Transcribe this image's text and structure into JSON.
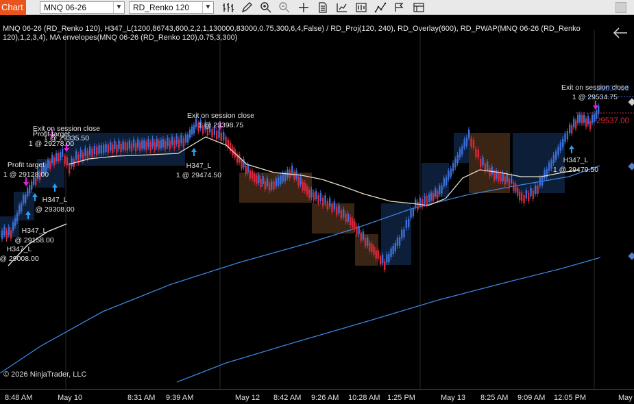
{
  "toolbar": {
    "chart_tab": "Chart",
    "instrument": "MNQ 06-26",
    "bar_type": "RD_Renko 120",
    "icons": [
      "bars-type-icon",
      "pencil-icon",
      "zoom-in-icon",
      "zoom-out-icon",
      "crosshair-icon",
      "data-box-icon",
      "indicators-icon",
      "strategies-icon",
      "drawing-tools-icon",
      "properties-icon",
      "order-entry-icon"
    ]
  },
  "chart": {
    "indicator_label": "MNQ 06-26 (RD_Renko 120), H347_L(1200,86743,600,2,2,1,130000,83000,0.75,300,6,4,False) / RD_Proj(120, 240), RD_Overlay(600), RD_PWAP(MNQ 06-26 (RD_Renko 120),1,2,3,4), MA envelopes(MNQ 06-26 (RD_Renko 120),0.75,3,300)",
    "copyright": "© 2026 NinjaTrader, LLC",
    "price_labels": [
      "29537.00",
      "29537.00"
    ],
    "colors": {
      "up": "#3a6fd8",
      "down": "#d8283a",
      "envelope": "#3a86e0",
      "pwap": "#e8e0cc",
      "box_blue": "#0d1e38",
      "box_brown": "#3a2414",
      "buy_arrow": "#2d9df0",
      "exit_arrow": "#e020e0",
      "price_red": "#d8283a",
      "price_blue": "#3a6fd8"
    },
    "annotations": [
      {
        "lines": [
          "Exit on session close",
          "1 @ 29398.75"
        ]
      },
      {
        "lines": [
          "Exit on session close",
          "1 @ 29335.50"
        ]
      },
      {
        "lines": [
          "Profit target",
          "1 @ 29278.00"
        ]
      },
      {
        "lines": [
          "Profit target",
          "1 @ 29128.00"
        ]
      },
      {
        "lines": [
          "H347_L",
          "@ 29308.00"
        ]
      },
      {
        "lines": [
          "H347_L",
          "@ 29158.00"
        ]
      },
      {
        "lines": [
          "H347_L",
          "@ 29008.00"
        ]
      },
      {
        "lines": [
          "H347_L",
          "1 @ 29474.50"
        ]
      },
      {
        "lines": [
          "Exit on session close",
          "1 @ 29534.75"
        ]
      },
      {
        "lines": [
          "H347_L",
          "1 @ 29479.50"
        ]
      }
    ]
  },
  "time_axis": {
    "ticks": [
      "8:48 AM",
      "May 10",
      "8:31 AM",
      "9:39 AM",
      "May 12",
      "8:42 AM",
      "9:26 AM",
      "10:28 AM",
      "1:25 PM",
      "May 13",
      "8:25 AM",
      "9:09 AM",
      "12:05 PM",
      "May"
    ]
  }
}
